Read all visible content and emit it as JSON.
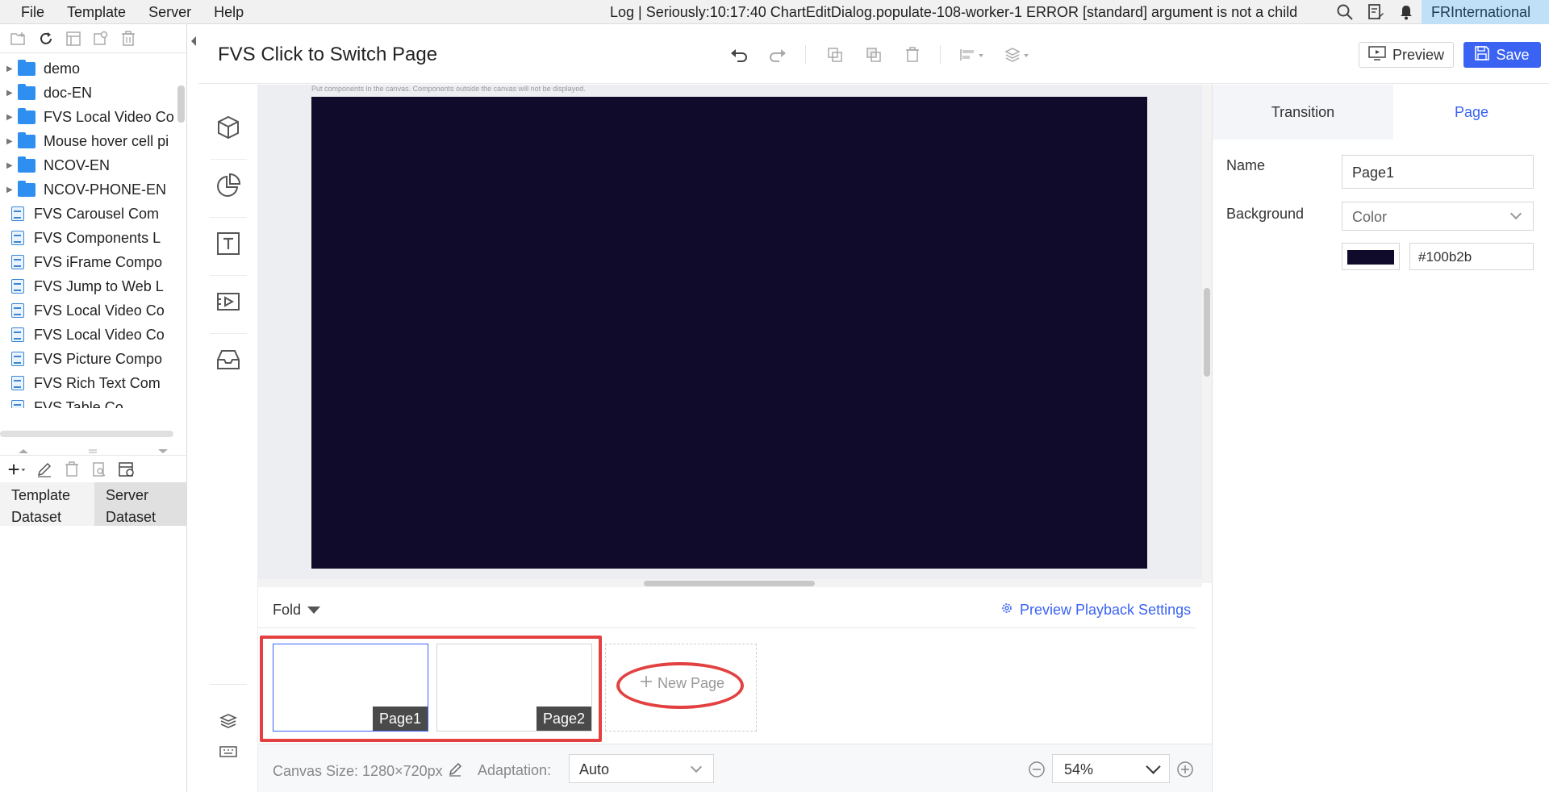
{
  "menu": {
    "items": [
      "File",
      "Template",
      "Server",
      "Help"
    ],
    "log_text": "Log | Seriously:10:17:40 ChartEditDialog.populate-108-worker-1 ERROR [standard] argument is not a child",
    "user": "FRInternational"
  },
  "tree": {
    "items": [
      {
        "label": "demo",
        "type": "folder"
      },
      {
        "label": "doc-EN",
        "type": "folder"
      },
      {
        "label": "FVS Local Video Co",
        "type": "folder"
      },
      {
        "label": "Mouse hover cell pi",
        "type": "folder"
      },
      {
        "label": "NCOV-EN",
        "type": "folder"
      },
      {
        "label": "NCOV-PHONE-EN",
        "type": "folder"
      },
      {
        "label": "FVS Carousel Com",
        "type": "file"
      },
      {
        "label": "FVS Components L",
        "type": "file"
      },
      {
        "label": "FVS iFrame Compo",
        "type": "file"
      },
      {
        "label": "FVS Jump to Web L",
        "type": "file"
      },
      {
        "label": "FVS Local Video Co",
        "type": "file"
      },
      {
        "label": "FVS Local Video Co",
        "type": "file"
      },
      {
        "label": "FVS Picture Compo",
        "type": "file"
      },
      {
        "label": "FVS Rich Text Com",
        "type": "file"
      },
      {
        "label": "FVS Table Co",
        "type": "file"
      }
    ]
  },
  "dataset_tabs": {
    "template": "Template Dataset",
    "server": "Server Dataset"
  },
  "header": {
    "title": "FVS Click to Switch Page",
    "preview_label": "Preview",
    "save_label": "Save",
    "accent_color": "#3a63f4"
  },
  "canvas": {
    "hint": "Put components in the canvas. Components outside the canvas will not be displayed.",
    "background_color": "#100b2b"
  },
  "page_strip": {
    "fold_label": "Fold",
    "playback_label": "Preview Playback Settings",
    "pages": [
      {
        "label": "Page1",
        "selected": true
      },
      {
        "label": "Page2",
        "selected": false
      }
    ],
    "new_page_label": "New Page"
  },
  "bottom_bar": {
    "canvas_size": "Canvas Size: 1280×720px",
    "adaptation_label": "Adaptation:",
    "adaptation_value": "Auto",
    "zoom_value": "54%"
  },
  "right_panel": {
    "tabs": [
      "Transition",
      "Page"
    ],
    "active_tab": "Page",
    "name_label": "Name",
    "name_value": "Page1",
    "background_label": "Background",
    "background_type": "Color",
    "color_hex": "#100b2b"
  },
  "annotation_color": "#e34141"
}
